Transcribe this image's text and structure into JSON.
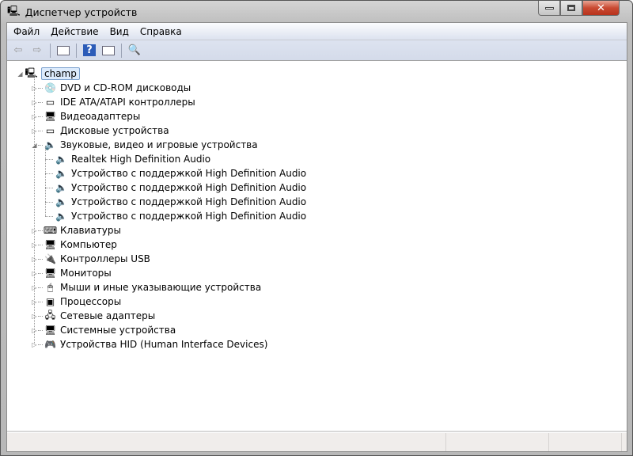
{
  "window": {
    "title": "Диспетчер устройств"
  },
  "menu": [
    "Файл",
    "Действие",
    "Вид",
    "Справка"
  ],
  "toolbar": {
    "back": "back-icon",
    "forward": "forward-icon",
    "console_tree": "console-tree-icon",
    "help": "?",
    "properties": "properties-icon",
    "scan": "scan-hardware-icon"
  },
  "tree": {
    "root": "champ",
    "categories": [
      {
        "label": "DVD и CD-ROM дисководы",
        "icon": "💿",
        "expanded": false
      },
      {
        "label": "IDE ATA/ATAPI контроллеры",
        "icon": "▭",
        "expanded": false
      },
      {
        "label": "Видеоадаптеры",
        "icon": "🖥",
        "expanded": false
      },
      {
        "label": "Дисковые устройства",
        "icon": "▭",
        "expanded": false
      },
      {
        "label": "Звуковые, видео и игровые устройства",
        "icon": "🔈",
        "expanded": true,
        "children": [
          "Realtek High Definition Audio",
          "Устройство с поддержкой High Definition Audio",
          "Устройство с поддержкой High Definition Audio",
          "Устройство с поддержкой High Definition Audio",
          "Устройство с поддержкой High Definition Audio"
        ]
      },
      {
        "label": "Клавиатуры",
        "icon": "⌨",
        "expanded": false
      },
      {
        "label": "Компьютер",
        "icon": "🖥",
        "expanded": false
      },
      {
        "label": "Контроллеры USB",
        "icon": "🔌",
        "expanded": false
      },
      {
        "label": "Мониторы",
        "icon": "🖥",
        "expanded": false
      },
      {
        "label": "Мыши и иные указывающие устройства",
        "icon": "🖱",
        "expanded": false
      },
      {
        "label": "Процессоры",
        "icon": "▣",
        "expanded": false
      },
      {
        "label": "Сетевые адаптеры",
        "icon": "🖧",
        "expanded": false
      },
      {
        "label": "Системные устройства",
        "icon": "🖥",
        "expanded": false
      },
      {
        "label": "Устройства HID (Human Interface Devices)",
        "icon": "🎮",
        "expanded": false
      }
    ]
  }
}
